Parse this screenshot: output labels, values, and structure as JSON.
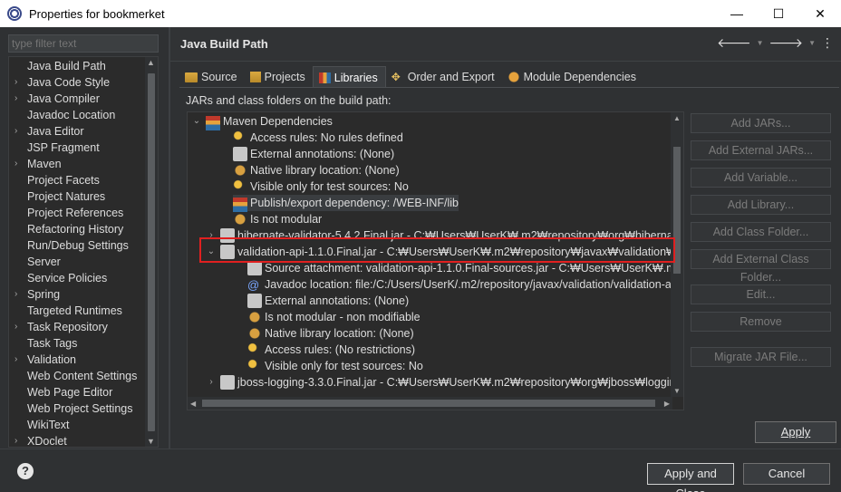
{
  "window": {
    "title": "Properties for bookmerket",
    "minimize": "—",
    "maximize": "☐",
    "close": "✕"
  },
  "filter": {
    "placeholder": "type filter text"
  },
  "nav": {
    "items": [
      {
        "label": "Java Build Path",
        "expandable": false
      },
      {
        "label": "Java Code Style",
        "expandable": true
      },
      {
        "label": "Java Compiler",
        "expandable": true
      },
      {
        "label": "Javadoc Location",
        "expandable": false
      },
      {
        "label": "Java Editor",
        "expandable": true
      },
      {
        "label": "JSP Fragment",
        "expandable": false
      },
      {
        "label": "Maven",
        "expandable": true
      },
      {
        "label": "Project Facets",
        "expandable": false
      },
      {
        "label": "Project Natures",
        "expandable": false
      },
      {
        "label": "Project References",
        "expandable": false
      },
      {
        "label": "Refactoring History",
        "expandable": false
      },
      {
        "label": "Run/Debug Settings",
        "expandable": false
      },
      {
        "label": "Server",
        "expandable": false
      },
      {
        "label": "Service Policies",
        "expandable": false
      },
      {
        "label": "Spring",
        "expandable": true
      },
      {
        "label": "Targeted Runtimes",
        "expandable": false
      },
      {
        "label": "Task Repository",
        "expandable": true
      },
      {
        "label": "Task Tags",
        "expandable": false
      },
      {
        "label": "Validation",
        "expandable": true
      },
      {
        "label": "Web Content Settings",
        "expandable": false
      },
      {
        "label": "Web Page Editor",
        "expandable": false
      },
      {
        "label": "Web Project Settings",
        "expandable": false
      },
      {
        "label": "WikiText",
        "expandable": false
      },
      {
        "label": "XDoclet",
        "expandable": true
      }
    ]
  },
  "header": {
    "title": "Java Build Path"
  },
  "tabs": [
    {
      "label": "Source"
    },
    {
      "label": "Projects"
    },
    {
      "label": "Libraries"
    },
    {
      "label": "Order and Export"
    },
    {
      "label": "Module Dependencies"
    }
  ],
  "jars_label": "JARs and class folders on the build path:",
  "tree": {
    "rows": [
      {
        "text": "Maven Dependencies",
        "toggle": "⌄",
        "icon": "maven"
      },
      {
        "text": "Access rules: No rules defined",
        "toggle": "",
        "icon": "key"
      },
      {
        "text": "External annotations: (None)",
        "toggle": "",
        "icon": "jar"
      },
      {
        "text": "Native library location: (None)",
        "toggle": "",
        "icon": "gear"
      },
      {
        "text": "Visible only for test sources: No",
        "toggle": "",
        "icon": "key"
      },
      {
        "text": "Publish/export dependency: /WEB-INF/lib",
        "toggle": "",
        "icon": "maven"
      },
      {
        "text": "Is not modular",
        "toggle": "",
        "icon": "gear"
      },
      {
        "text": "hibernate-validator-5.4.2.Final.jar - C:₩Users₩UserK₩.m2₩repository₩org₩hibernate₩",
        "toggle": "›",
        "icon": "jar"
      },
      {
        "text": "validation-api-1.1.0.Final.jar - C:₩Users₩UserK₩.m2₩repository₩javax₩validation₩va",
        "toggle": "⌄",
        "icon": "jar"
      },
      {
        "text": "Source attachment: validation-api-1.1.0.Final-sources.jar - C:₩Users₩UserK₩.m2₩",
        "toggle": "",
        "icon": "jar"
      },
      {
        "text": "Javadoc location: file:/C:/Users/UserK/.m2/repository/javax/validation/validation-ap",
        "toggle": "",
        "icon": "at"
      },
      {
        "text": "External annotations: (None)",
        "toggle": "",
        "icon": "jar"
      },
      {
        "text": "Is not modular - non modifiable",
        "toggle": "",
        "icon": "gear"
      },
      {
        "text": "Native library location: (None)",
        "toggle": "",
        "icon": "gear"
      },
      {
        "text": "Access rules: (No restrictions)",
        "toggle": "",
        "icon": "key"
      },
      {
        "text": "Visible only for test sources: No",
        "toggle": "",
        "icon": "key"
      },
      {
        "text": "jboss-logging-3.3.0.Final.jar - C:₩Users₩UserK₩.m2₩repository₩org₩jboss₩logging₩",
        "toggle": "›",
        "icon": "jar"
      }
    ]
  },
  "side_buttons": [
    {
      "label": "Add JARs..."
    },
    {
      "label": "Add External JARs..."
    },
    {
      "label": "Add Variable..."
    },
    {
      "label": "Add Library..."
    },
    {
      "label": "Add Class Folder..."
    },
    {
      "label": "Add External Class Folder..."
    },
    {
      "label": "Edit..."
    },
    {
      "label": "Remove"
    },
    {
      "label": "Migrate JAR File..."
    }
  ],
  "apply": "Apply",
  "footer": {
    "help": "?",
    "apply_close": "Apply and Close",
    "cancel": "Cancel"
  }
}
